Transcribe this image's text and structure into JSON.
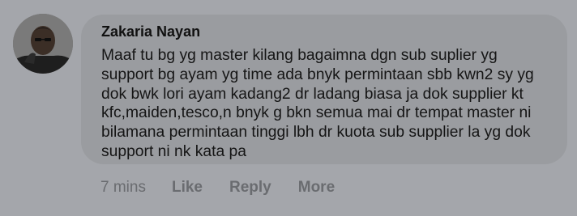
{
  "comment": {
    "author": "Zakaria Nayan",
    "text": "Maaf tu bg yg master kilang bagaimna dgn sub suplier yg\nsupport bg ayam yg time ada bnyk permintaan sbb kwn2 sy yg\ndok bwk lori ayam kadang2 dr ladang biasa ja dok supplier kt\nkfc,maiden,tesco,n bnyk g bkn semua mai dr tempat master ni\nbilamana permintaan tinggi lbh dr kuota sub supplier la yg dok\nsupport ni nk kata pa",
    "timestamp": "7 mins",
    "actions": {
      "like": "Like",
      "reply": "Reply",
      "more": "More"
    },
    "avatar_icon": "user-avatar-photo"
  },
  "colors": {
    "background": "#a4a6ab",
    "bubble": "#9a9ca0",
    "meta_text": "#6a6c70"
  }
}
